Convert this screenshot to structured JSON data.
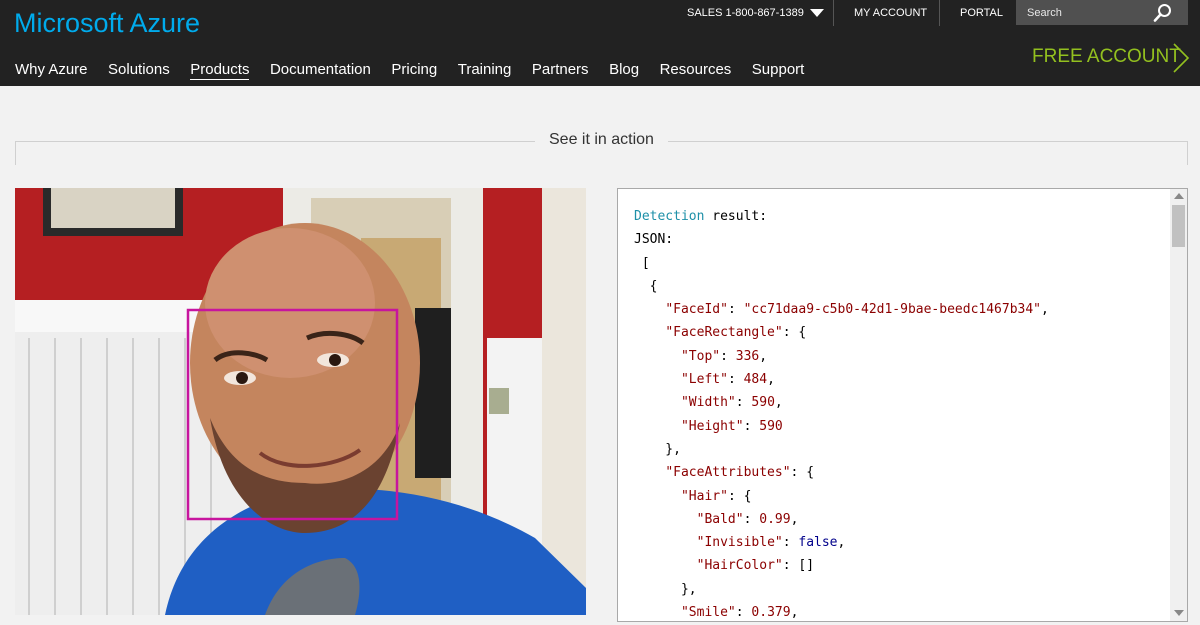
{
  "header": {
    "logo": "Microsoft Azure",
    "sales": "SALES 1-800-867-1389",
    "my_account": "MY ACCOUNT",
    "portal": "PORTAL",
    "search_placeholder": "Search",
    "free_account": "FREE ACCOUNT",
    "nav": [
      "Why Azure",
      "Solutions",
      "Products",
      "Documentation",
      "Pricing",
      "Training",
      "Partners",
      "Blog",
      "Resources",
      "Support"
    ],
    "active_nav": "Products"
  },
  "section": {
    "title": "See it in action"
  },
  "detection": {
    "heading_word": "Detection",
    "heading_rest": " result:",
    "json_label": "JSON:",
    "open_bracket": " [",
    "open_brace": "  {",
    "face_id_key": "\"FaceId\"",
    "face_id_value": "\"cc71daa9-c5b0-42d1-9bae-beedc1467b34\"",
    "face_rect_key": "\"FaceRectangle\"",
    "top_key": "\"Top\"",
    "top_value": "336",
    "left_key": "\"Left\"",
    "left_value": "484",
    "width_key": "\"Width\"",
    "width_value": "590",
    "height_key": "\"Height\"",
    "height_value": "590",
    "face_attr_key": "\"FaceAttributes\"",
    "hair_key": "\"Hair\"",
    "bald_key": "\"Bald\"",
    "bald_value": "0.99",
    "invisible_key": "\"Invisible\"",
    "invisible_value": "false",
    "haircolor_key": "\"HairColor\"",
    "haircolor_value": "[]",
    "smile_key": "\"Smile\"",
    "smile_value": "0.379"
  },
  "colors": {
    "header_bg": "#222222",
    "logo": "#00abec",
    "free_account": "#93c01f",
    "face_box": "#c7159e"
  },
  "icons": [
    "caret-down-icon",
    "search-icon",
    "chevron-right-icon"
  ]
}
